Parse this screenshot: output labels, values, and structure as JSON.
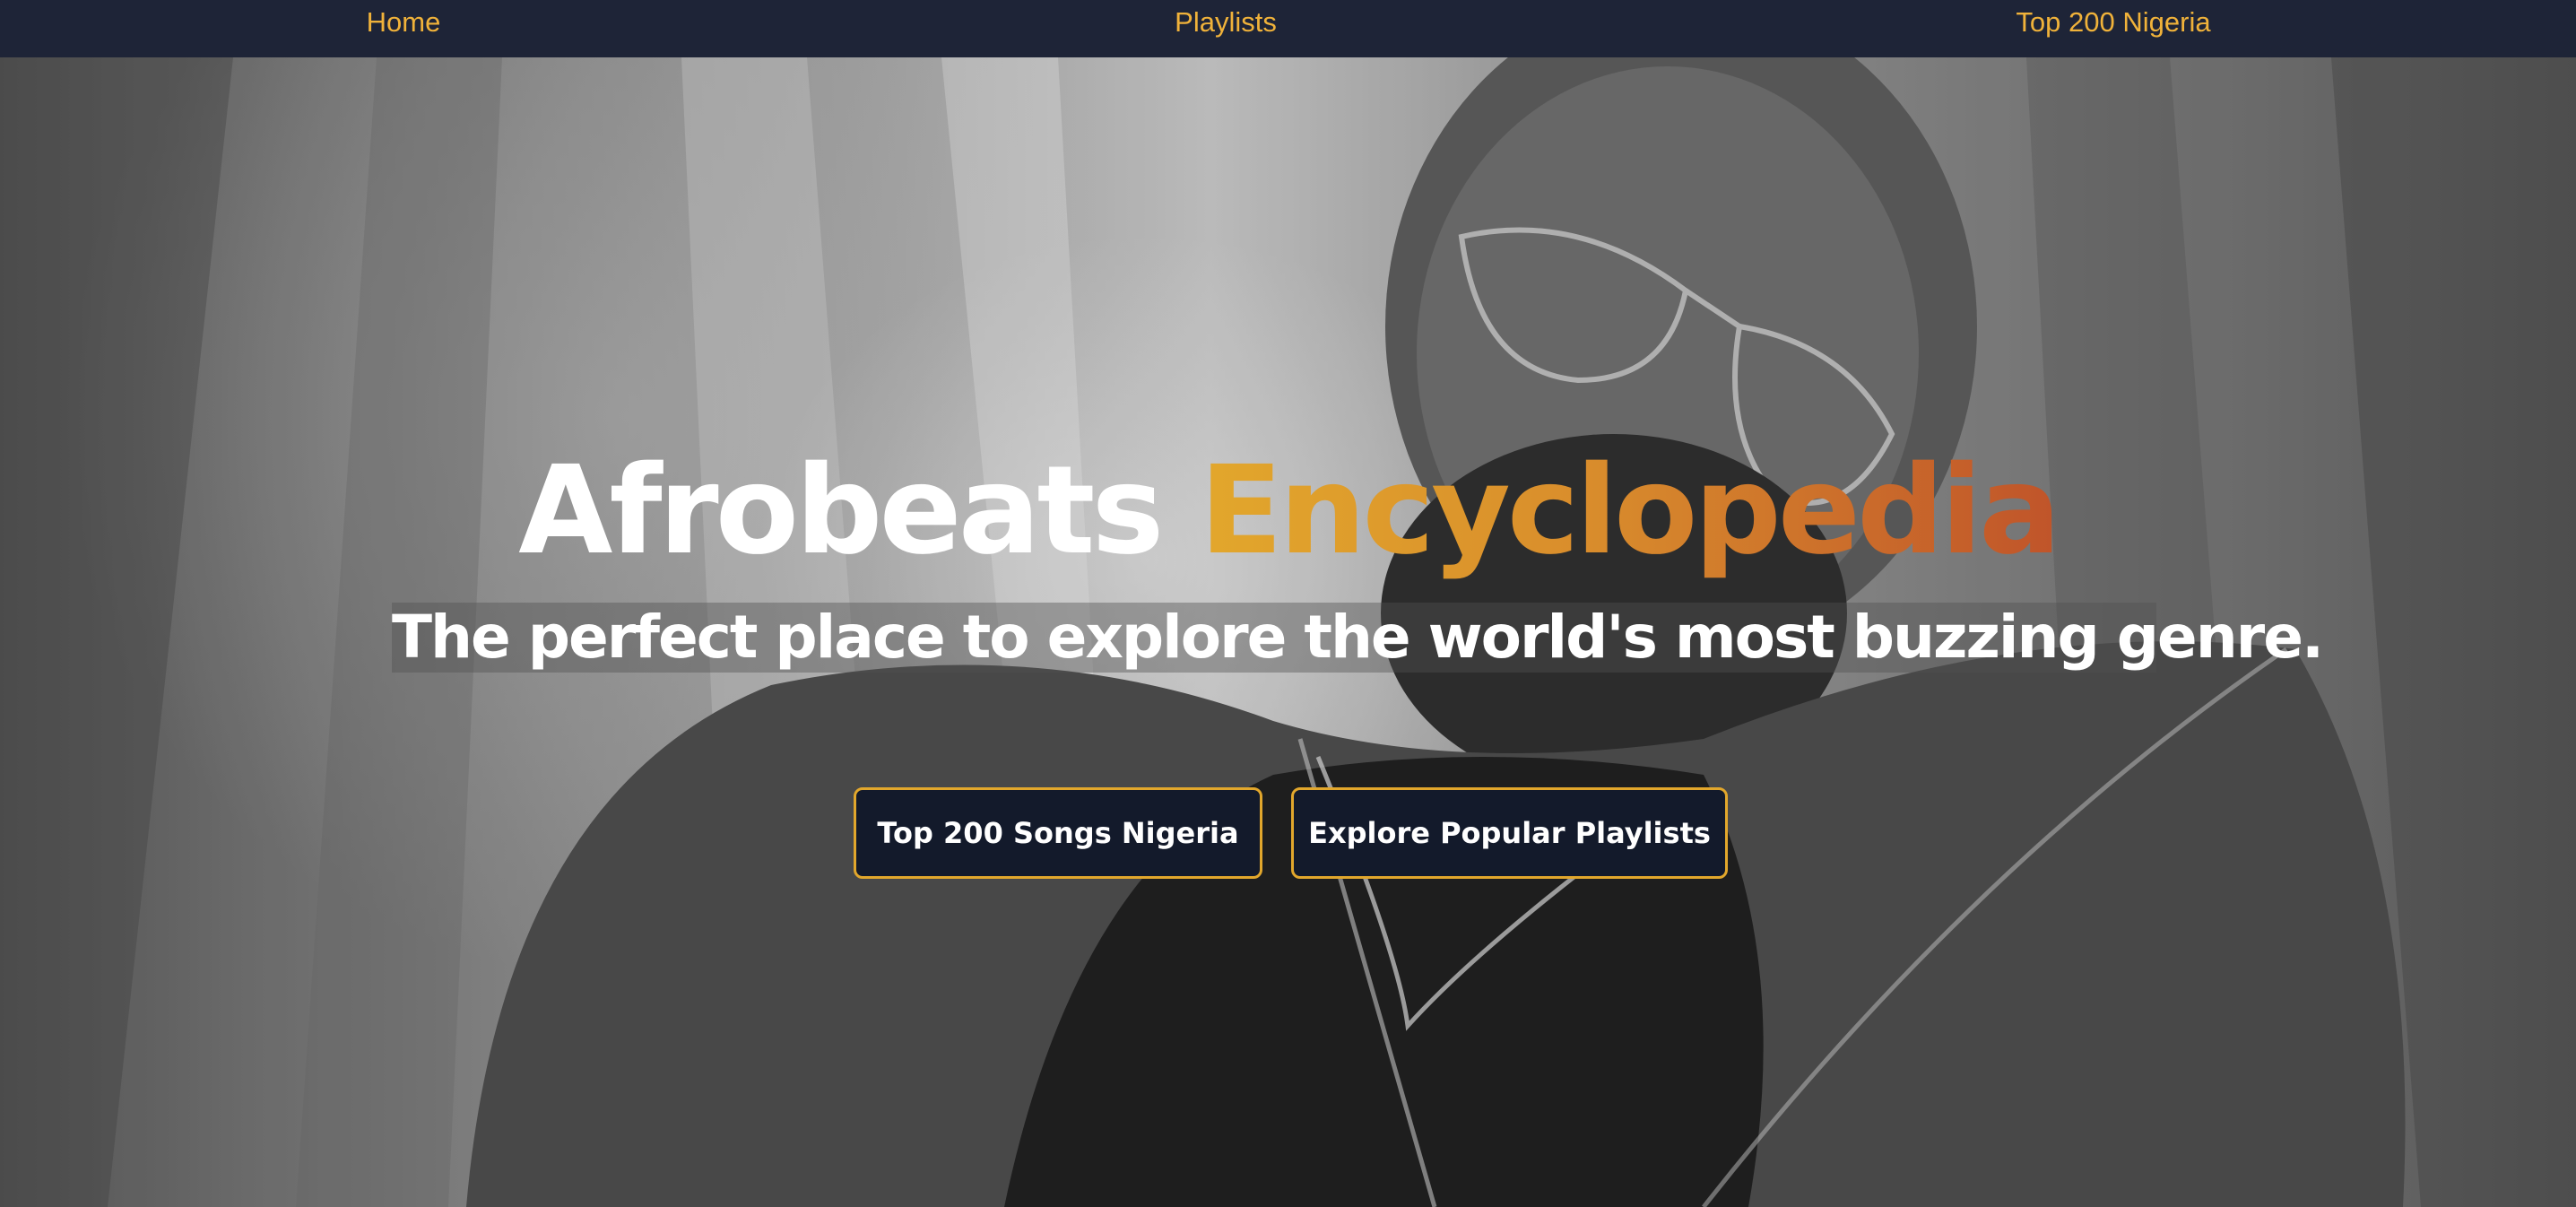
{
  "nav": {
    "items": [
      {
        "label": "Home"
      },
      {
        "label": "Playlists"
      },
      {
        "label": "Top 200 Nigeria"
      }
    ]
  },
  "hero": {
    "title_plain": "Afrobeats",
    "title_accent": "Encyclopedia",
    "tagline": "The perfect place to explore the world's most buzzing genre.",
    "image_description": "",
    "buttons": [
      {
        "label": "Top 200 Songs Nigeria"
      },
      {
        "label": "Explore Popular Playlists"
      }
    ]
  },
  "colors": {
    "nav_background": "#1e2437",
    "nav_link": "#f0b23a",
    "accent_gradient_start": "#e2a72c",
    "accent_gradient_end": "#c0542a",
    "button_background": "#131a2b",
    "button_border": "#e2a72c"
  }
}
